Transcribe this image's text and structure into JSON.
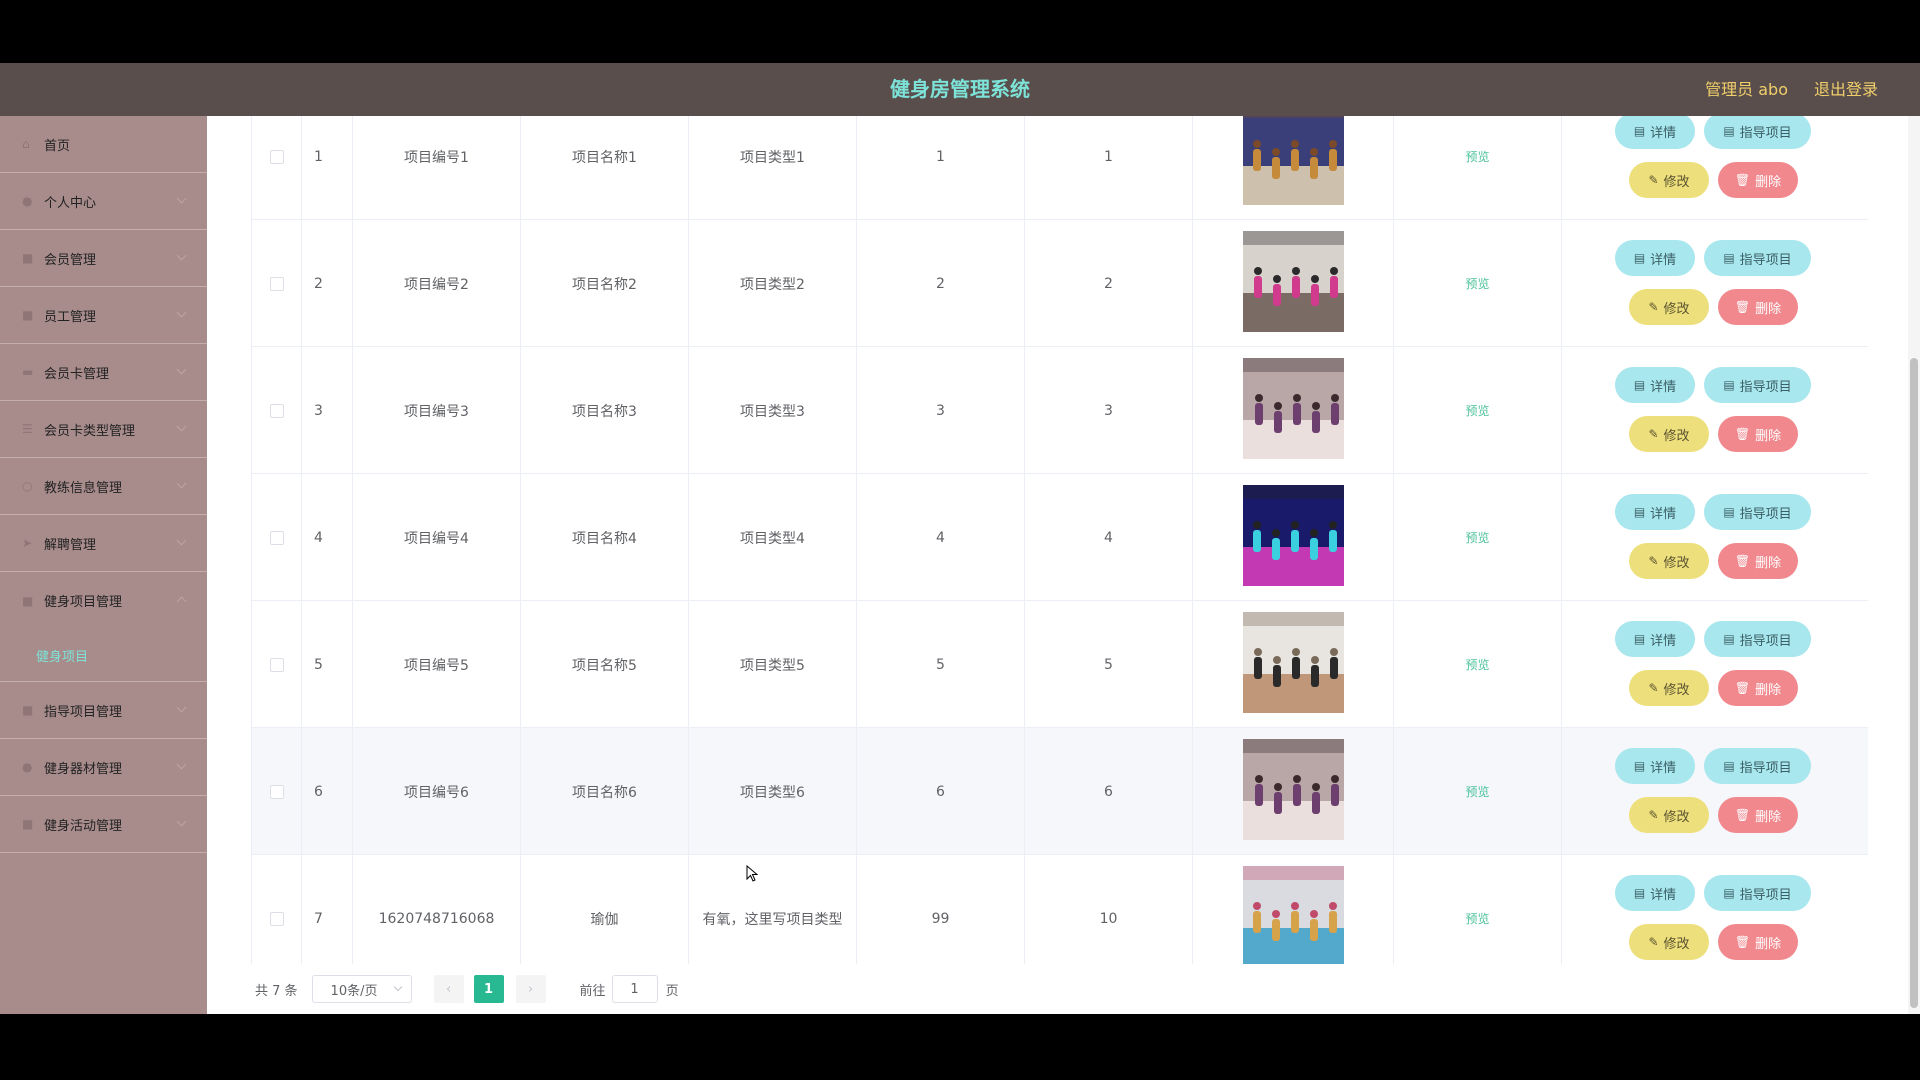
{
  "header": {
    "title": "健身房管理系统",
    "admin": "管理员 abo",
    "logout": "退出登录"
  },
  "sidebar": {
    "items": [
      {
        "label": "首页",
        "icon": "home-icon"
      },
      {
        "label": "个人中心",
        "icon": "user-icon"
      },
      {
        "label": "会员管理",
        "icon": "grid-icon"
      },
      {
        "label": "员工管理",
        "icon": "grid-icon"
      },
      {
        "label": "会员卡管理",
        "icon": "card-icon"
      },
      {
        "label": "会员卡类型管理",
        "icon": "list-icon"
      },
      {
        "label": "教练信息管理",
        "icon": "info-icon"
      },
      {
        "label": "解聘管理",
        "icon": "send-icon"
      },
      {
        "label": "健身项目管理",
        "icon": "grid-icon"
      },
      {
        "label": "指导项目管理",
        "icon": "grid-icon"
      },
      {
        "label": "健身器材管理",
        "icon": "user-icon"
      },
      {
        "label": "健身活动管理",
        "icon": "grid-icon"
      }
    ],
    "submenu": {
      "label": "健身项目"
    }
  },
  "table": {
    "preview_label": "预览",
    "buttons": {
      "detail": "详情",
      "guide": "指导项目",
      "edit": "修改",
      "delete": "删除"
    },
    "rows": [
      {
        "idx": "1",
        "no": "项目编号1",
        "name": "项目名称1",
        "type": "项目类型1",
        "a": "1",
        "b": "1",
        "img": "yoga-class-photo"
      },
      {
        "idx": "2",
        "no": "项目编号2",
        "name": "项目名称2",
        "type": "项目类型2",
        "a": "2",
        "b": "2",
        "img": "aerial-yoga-photo"
      },
      {
        "idx": "3",
        "no": "项目编号3",
        "name": "项目名称3",
        "type": "项目类型3",
        "a": "3",
        "b": "3",
        "img": "yoga-studio-photo"
      },
      {
        "idx": "4",
        "no": "项目编号4",
        "name": "项目名称4",
        "type": "项目类型4",
        "a": "4",
        "b": "4",
        "img": "spinning-class-photo"
      },
      {
        "idx": "5",
        "no": "项目编号5",
        "name": "项目名称5",
        "type": "项目类型5",
        "a": "5",
        "b": "5",
        "img": "aerial-fitness-photo"
      },
      {
        "idx": "6",
        "no": "项目编号6",
        "name": "项目名称6",
        "type": "项目类型6",
        "a": "6",
        "b": "6",
        "img": "yoga-studio-photo"
      },
      {
        "idx": "7",
        "no": "1620748716068",
        "name": "瑜伽",
        "type": "有氧，这里写项目类型",
        "a": "99",
        "b": "10",
        "img": "group-yoga-photo"
      }
    ]
  },
  "pager": {
    "total": "共 7 条",
    "page_size": "10条/页",
    "prev": "‹",
    "next": "›",
    "current": "1",
    "goto": "前往",
    "jump_value": "1",
    "page_unit": "页"
  },
  "colors": {
    "header_bg": "#5a4e4c",
    "title": "#7de3d8",
    "sidebar_bg": "#a88c8c",
    "accent": "#29b992"
  }
}
